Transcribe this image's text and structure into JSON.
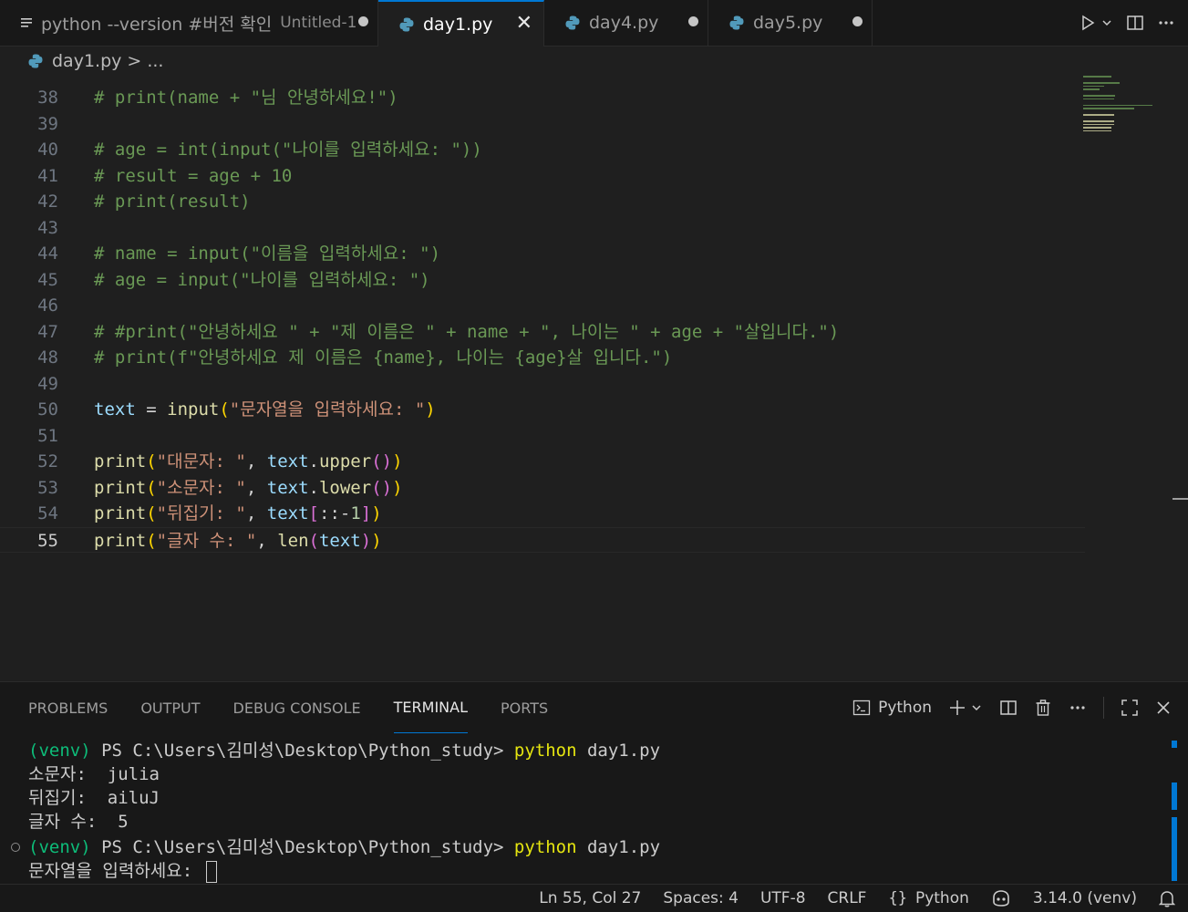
{
  "tabs": [
    {
      "label": "python --version #버전 확인",
      "description": "Untitled-1",
      "icon": "list-icon",
      "dirty": true
    },
    {
      "label": "day1.py",
      "icon": "python-icon",
      "active": true,
      "close": "✕"
    },
    {
      "label": "day4.py",
      "icon": "python-icon",
      "dirty": true
    },
    {
      "label": "day5.py",
      "icon": "python-icon",
      "dirty": true
    }
  ],
  "breadcrumb": {
    "file": "day1.py",
    "separator": ">",
    "rest": "..."
  },
  "editor": {
    "lines": [
      {
        "n": "38",
        "code": "# print(name + \"님 안녕하세요!\")"
      },
      {
        "n": "39",
        "code": ""
      },
      {
        "n": "40",
        "code": "# age = int(input(\"나이를 입력하세요: \"))"
      },
      {
        "n": "41",
        "code": "# result = age + 10"
      },
      {
        "n": "42",
        "code": "# print(result)"
      },
      {
        "n": "43",
        "code": ""
      },
      {
        "n": "44",
        "code": "# name = input(\"이름을 입력하세요: \")"
      },
      {
        "n": "45",
        "code": "# age = input(\"나이를 입력하세요: \")"
      },
      {
        "n": "46",
        "code": ""
      },
      {
        "n": "47",
        "code": "# #print(\"안녕하세요 \" + \"제 이름은 \" + name + \", 나이는 \" + age + \"살입니다.\")"
      },
      {
        "n": "48",
        "code": "# print(f\"안녕하세요 제 이름은 {name}, 나이는 {age}살 입니다.\")"
      },
      {
        "n": "49",
        "code": ""
      },
      {
        "n": "50",
        "code": "text = input(\"문자열을 입력하세요: \")"
      },
      {
        "n": "51",
        "code": ""
      },
      {
        "n": "52",
        "code": "print(\"대문자: \", text.upper())"
      },
      {
        "n": "53",
        "code": "print(\"소문자: \", text.lower())"
      },
      {
        "n": "54",
        "code": "print(\"뒤집기: \", text[::-1])"
      },
      {
        "n": "55",
        "code": "print(\"글자 수: \", len(text))",
        "current": true
      }
    ]
  },
  "panel": {
    "tabs": [
      "PROBLEMS",
      "OUTPUT",
      "DEBUG CONSOLE",
      "TERMINAL",
      "PORTS"
    ],
    "active_tab": "TERMINAL",
    "terminal_profile": "Python"
  },
  "terminal": {
    "lines": [
      {
        "venv": "(venv)",
        "prompt": " PS C:\\Users\\김미성\\Desktop\\Python_study> ",
        "cmd": "python",
        "args": " day1.py"
      },
      {
        "text": "소문자:  julia"
      },
      {
        "text": "뒤집기:  ailuJ"
      },
      {
        "text": "글자 수:  5"
      },
      {
        "venv": "(venv)",
        "prompt": " PS C:\\Users\\김미성\\Desktop\\Python_study> ",
        "cmd": "python",
        "args": " day1.py"
      },
      {
        "text": "문자열을 입력하세요: ",
        "cursor": true
      }
    ]
  },
  "statusbar": {
    "position": "Ln 55, Col 27",
    "spaces": "Spaces: 4",
    "encoding": "UTF-8",
    "eol": "CRLF",
    "language": "Python",
    "interpreter": "3.14.0 (venv)"
  },
  "colors": {
    "accent": "#0078d4",
    "comment": "#6a9955",
    "string": "#ce9178",
    "variable": "#9cdcfe",
    "function": "#dcdcaa",
    "number": "#b5cea8",
    "venv": "#0dbc79",
    "command": "#e5e510"
  }
}
